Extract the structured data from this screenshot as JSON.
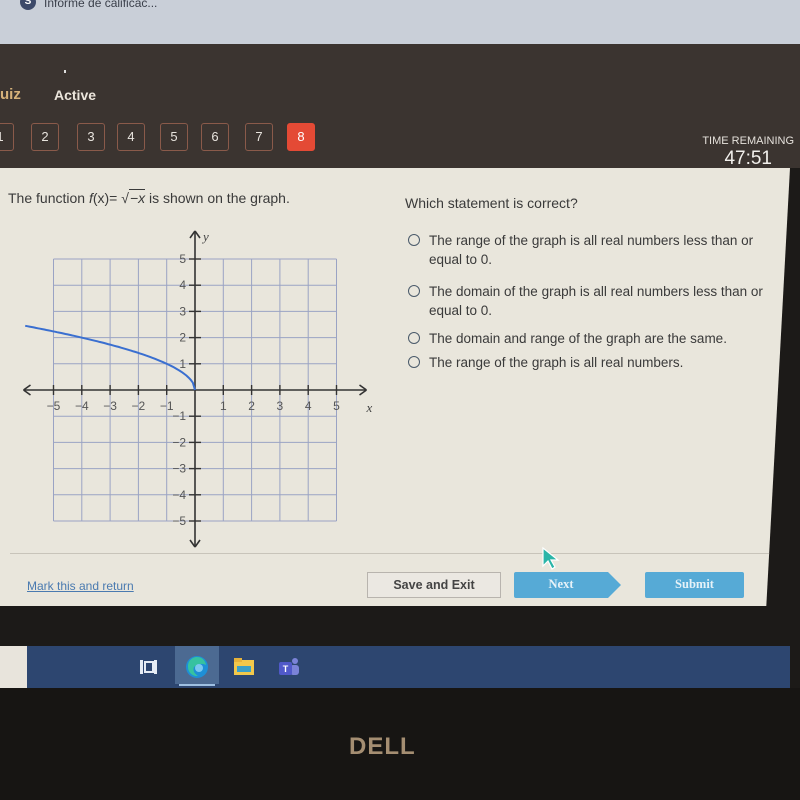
{
  "browser": {
    "tab_favicon": "S",
    "tab_title": "Informe de calificac..."
  },
  "header": {
    "section_label": "uiz",
    "status_label": "Active",
    "question_nav": [
      {
        "label": "1",
        "active": false
      },
      {
        "label": "2",
        "active": false
      },
      {
        "label": "3",
        "active": false
      },
      {
        "label": "4",
        "active": false
      },
      {
        "label": "5",
        "active": false
      },
      {
        "label": "6",
        "active": false
      },
      {
        "label": "7",
        "active": false
      },
      {
        "label": "8",
        "active": true
      }
    ],
    "time_remaining_label": "TIME REMAINING",
    "time_remaining_value": "47:51",
    "active_color": "#e44a35"
  },
  "prompt": {
    "prefix": "The function ",
    "func_name": "f",
    "func_arg": "(x)= ",
    "radical": "√",
    "radicand": "−x",
    "suffix": " is shown on the graph."
  },
  "question": {
    "text": "Which statement is correct?",
    "options": [
      {
        "text": "The range of the graph is all real numbers less than or equal to 0.",
        "selected": false
      },
      {
        "text": "The domain of the graph is all real numbers less than or equal to 0.",
        "selected": false
      },
      {
        "text": "The domain and range of the graph are the same.",
        "selected": false
      },
      {
        "text": "The range of the graph is all real numbers.",
        "selected": false
      }
    ]
  },
  "chart_data": {
    "type": "line",
    "title": "",
    "function": "f(x) = sqrt(-x)",
    "xlabel": "x",
    "ylabel": "y",
    "xlim": [
      -5,
      5
    ],
    "ylim": [
      -5,
      5
    ],
    "x_ticks": [
      -5,
      -4,
      -3,
      -2,
      -1,
      1,
      2,
      3,
      4,
      5
    ],
    "y_ticks": [
      -5,
      -4,
      -3,
      -2,
      -1,
      1,
      2,
      3,
      4,
      5
    ],
    "grid": true,
    "series": [
      {
        "name": "f(x)",
        "color": "#3a6fd0",
        "x": [
          -6,
          -5,
          -4,
          -3,
          -2,
          -1,
          -0.5,
          -0.25,
          0
        ],
        "y": [
          2.449,
          2.236,
          2.0,
          1.732,
          1.414,
          1.0,
          0.707,
          0.5,
          0
        ]
      }
    ]
  },
  "footer": {
    "mark_link": "Mark this and return",
    "save_exit": "Save and Exit",
    "next": "Next",
    "submit": "Submit",
    "button_color": "#56aad6"
  },
  "taskbar": {
    "icons": [
      "task-view-icon",
      "edge-browser-icon",
      "file-explorer-icon",
      "teams-icon"
    ]
  },
  "bezel": {
    "brand": "DELL"
  }
}
